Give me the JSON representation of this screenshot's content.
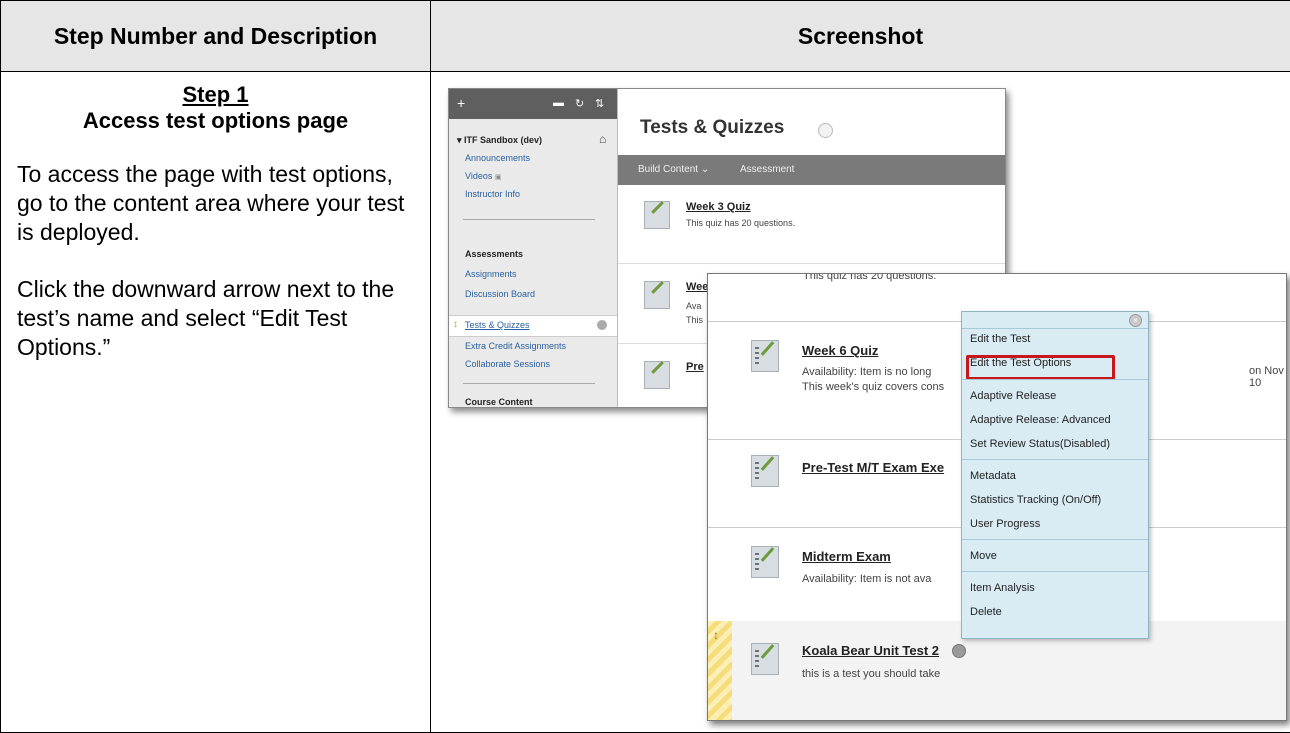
{
  "header": {
    "col1": "Step Number and Description",
    "col2": "Screenshot"
  },
  "step": {
    "label": "Step 1",
    "title": "Access test options page",
    "p1": "To access the page with test options, go to the content area where your test is deployed.",
    "p2": "Click the downward arrow next to the test’s name and select “Edit Test Options.”"
  },
  "shot1": {
    "toolbar_plus": "+",
    "course": "ITF Sandbox (dev)",
    "links1": [
      "Announcements",
      "Videos",
      "Instructor Info"
    ],
    "section1": "Assessments",
    "links2": [
      "Assignments",
      "Discussion Board"
    ],
    "active": "Tests & Quizzes",
    "links3": [
      "Extra Credit Assignments",
      "Collaborate Sessions"
    ],
    "section2": "Course Content",
    "page_title": "Tests & Quizzes",
    "bar_build": "Build Content ⌄",
    "bar_assess": "Assessment",
    "item1_title": "Week 3 Quiz",
    "item1_desc": "This quiz has 20 questions.",
    "item2_title": "Wee",
    "item2_avail": "Ava",
    "item2_desc": "This",
    "item3_title": "Pre"
  },
  "shot2": {
    "top_text": "This quiz has 20 questions.",
    "item1_title": "Week 6 Quiz",
    "item1_avail": "Availability:  Item is no long",
    "item1_right": "on Nov 10",
    "item1_desc": "This week's quiz covers cons",
    "item2_title": "Pre-Test M/T Exam Exe",
    "item3_title": "Midterm Exam",
    "item3_avail": "Availability:  Item is not ava",
    "item4_title": "Koala Bear Unit Test 2",
    "item4_desc": "this is a test you should take",
    "menu": {
      "items": [
        "Edit the Test",
        "Edit the Test Options",
        "Adaptive Release",
        "Adaptive Release: Advanced",
        "Set Review Status(Disabled)",
        "Metadata",
        "Statistics Tracking (On/Off)",
        "User Progress",
        "Move",
        "Item Analysis",
        "Delete"
      ]
    }
  }
}
